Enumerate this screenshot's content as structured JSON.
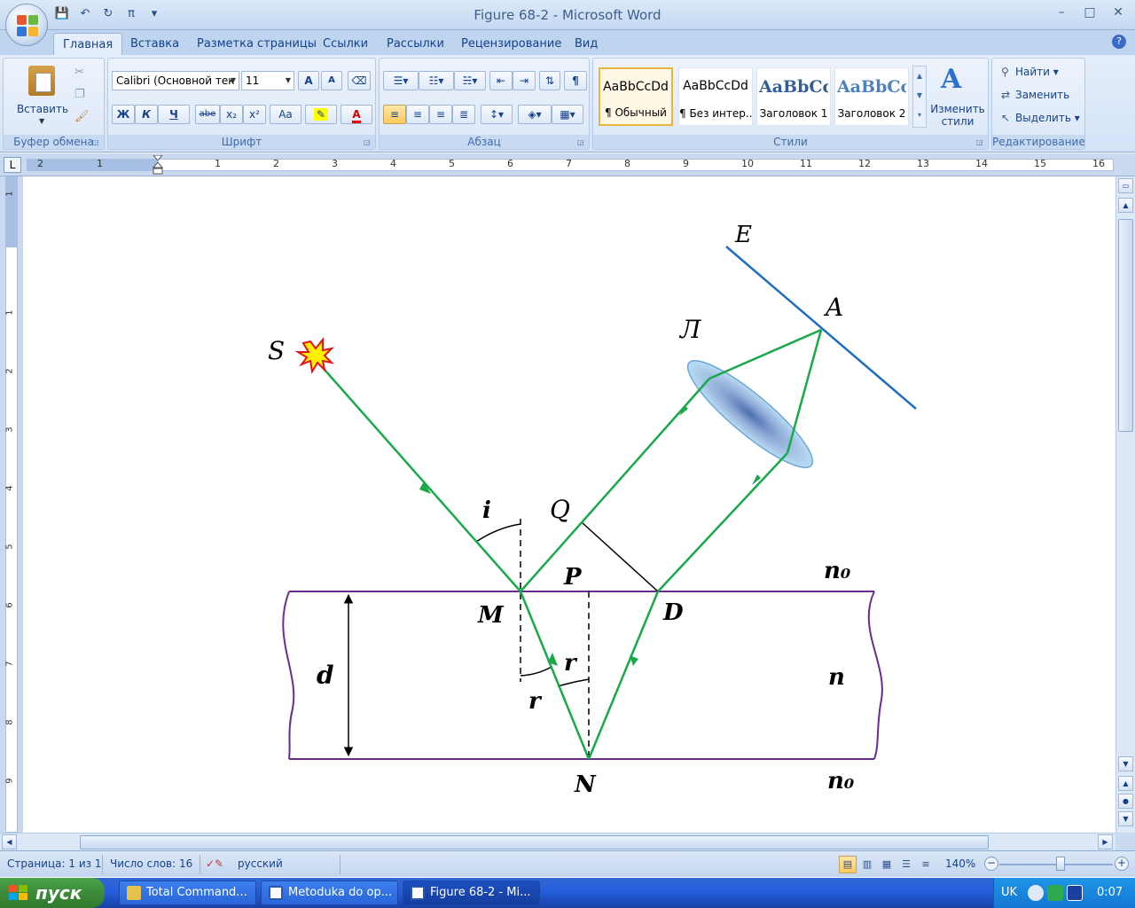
{
  "window": {
    "title": "Figure 68-2 - Microsoft Word",
    "controls": {
      "minimize": "–",
      "maximize": "□",
      "close": "✕"
    }
  },
  "qat": {
    "save": "💾",
    "undo": "↶",
    "redo": "↻",
    "pi": "π",
    "more": "▾"
  },
  "tabs": [
    "Главная",
    "Вставка",
    "Разметка страницы",
    "Ссылки",
    "Рассылки",
    "Рецензирование",
    "Вид"
  ],
  "help": "?",
  "ribbon": {
    "clipboard": {
      "label": "Буфер обмена",
      "paste": "Вставить"
    },
    "font": {
      "label": "Шрифт",
      "font_name": "Calibri (Основной тек",
      "font_size": "11",
      "grow": "A",
      "shrink": "A",
      "bold": "Ж",
      "italic": "К",
      "underline": "Ч",
      "strike": "abe",
      "sub": "x₂",
      "sup": "x²",
      "case": "Aa"
    },
    "paragraph": {
      "label": "Абзац",
      "pilcrow": "¶"
    },
    "styles": {
      "label": "Стили",
      "items": [
        {
          "sample": "AaBbCcDd",
          "name": "¶ Обычный"
        },
        {
          "sample": "AaBbCcDd",
          "name": "¶ Без интер..."
        },
        {
          "sample": "AaBbCc",
          "name": "Заголовок 1"
        },
        {
          "sample": "AaBbCc",
          "name": "Заголовок 2"
        }
      ],
      "change_line1": "Изменить",
      "change_line2": "стили"
    },
    "editing": {
      "label": "Редактирование",
      "find": "Найти",
      "replace": "Заменить",
      "select": "Выделить"
    }
  },
  "ruler": {
    "corner": "L",
    "h_numbers": [
      "2",
      "1",
      "1",
      "1",
      "2",
      "3",
      "4",
      "5",
      "6",
      "7",
      "8",
      "9",
      "10",
      "11",
      "12",
      "13",
      "14",
      "15",
      "16"
    ],
    "v_numbers": [
      "1",
      "1",
      "2",
      "3",
      "4",
      "5",
      "6",
      "7",
      "8",
      "9"
    ]
  },
  "diagram": {
    "labels": {
      "S": "S",
      "E": "E",
      "A": "A",
      "L": "Л",
      "Q": "Q",
      "i": "i",
      "P": "P",
      "n0_top": "n₀",
      "M": "M",
      "D": "D",
      "d": "d",
      "r1": "r",
      "r2": "r",
      "n": "n",
      "N": "N",
      "n0_bottom": "n₀"
    },
    "colors": {
      "ray": "#1aa84a",
      "plate": "#6a2c91",
      "screen": "#1f6dbf",
      "lens": "#9cc8e8"
    }
  },
  "statusbar": {
    "page": "Страница: 1 из 1",
    "words": "Число слов: 16",
    "language": "русский",
    "zoom": "140%"
  },
  "taskbar": {
    "start": "пуск",
    "tasks": [
      "Total Command...",
      "Metoduka do op...",
      "Figure 68-2 - Mi..."
    ],
    "lang": "UK",
    "time": "0:07"
  }
}
